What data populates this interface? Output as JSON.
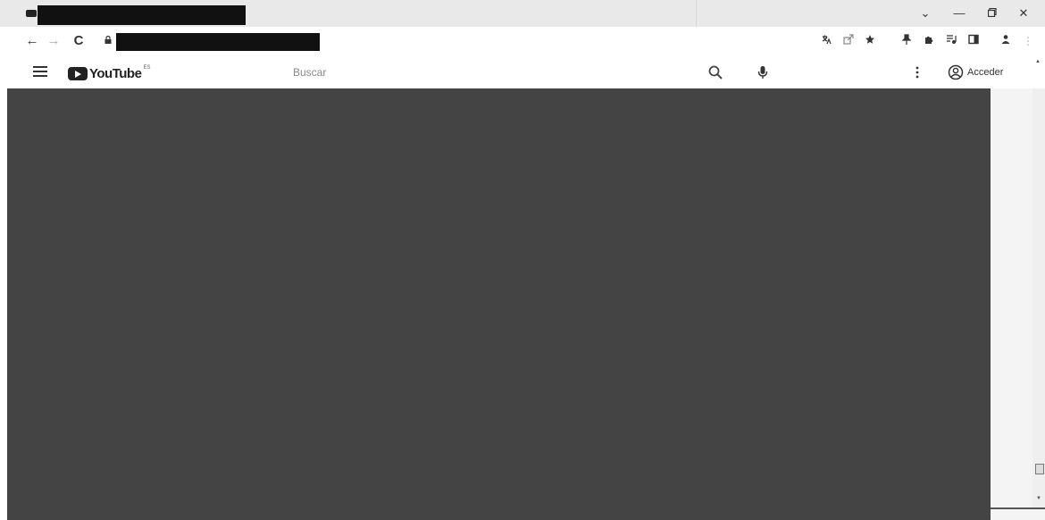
{
  "browser": {
    "tab": {
      "favicon": "youtube-favicon",
      "title_redacted": true
    },
    "window_controls": {
      "tab_search": "⌄",
      "minimize": "—",
      "restore": "restore-icon",
      "close": "✕"
    },
    "nav": {
      "back": "←",
      "forward": "→",
      "reload": "C"
    },
    "address": {
      "lock_icon": "lock-icon",
      "url_redacted": true
    },
    "extensions": [
      "translate-icon",
      "share-icon",
      "star-icon",
      "pin-icon",
      "extensions-puzzle-icon",
      "media-icon",
      "sidepanel-icon",
      "profile-icon",
      "menu-kebab-icon"
    ]
  },
  "youtube": {
    "menu_icon": "hamburger-icon",
    "logo_text": "YouTube",
    "logo_country": "ES",
    "search_placeholder": "Buscar",
    "signin_label": "Acceder"
  },
  "content": {
    "redacted": true,
    "redaction_color": "#444444"
  },
  "colors": {
    "titlebar": "#e9e9e9",
    "page": "#ffffff",
    "redaction": "#111111"
  }
}
